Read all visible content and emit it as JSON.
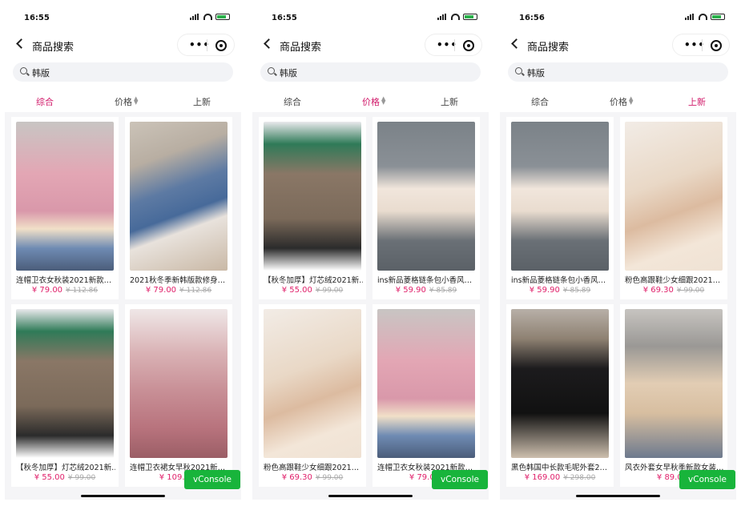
{
  "screens": [
    {
      "time": "16:55",
      "nav_title": "商品搜索",
      "search_query": "韩版",
      "sort": {
        "active": 0,
        "tabs": [
          "综合",
          "价格",
          "上新"
        ]
      },
      "products": [
        {
          "name": "连帽卫衣女秋装2021新款…",
          "price": "¥ 79.00",
          "old_price": "¥ 112.86",
          "image": "pink-hoodie"
        },
        {
          "name": "2021秋冬季新韩版款修身…",
          "price": "¥ 79.00",
          "old_price": "¥ 112.86",
          "image": "jeans-fur"
        },
        {
          "name": "【秋冬加厚】灯芯绒2021新…",
          "price": "¥ 55.00",
          "old_price": "¥ 99.00",
          "image": "corduroy"
        },
        {
          "name": "连帽卫衣裙女早秋2021新…",
          "price": "¥ 109.00",
          "old_price": "",
          "image": "pink-dress"
        }
      ],
      "vconsole": "vConsole"
    },
    {
      "time": "16:55",
      "nav_title": "商品搜索",
      "search_query": "韩版",
      "sort": {
        "active": 1,
        "tabs": [
          "综合",
          "价格",
          "上新"
        ]
      },
      "products": [
        {
          "name": "【秋冬加厚】灯芯绒2021新…",
          "price": "¥ 55.00",
          "old_price": "¥ 99.00",
          "image": "corduroy"
        },
        {
          "name": "ins新品菱格链条包小香风…",
          "price": "¥ 59.90",
          "old_price": "¥ 85.89",
          "image": "bag"
        },
        {
          "name": "粉色高跟鞋少女细跟2021…",
          "price": "¥ 69.30",
          "old_price": "¥ 99.00",
          "image": "heels"
        },
        {
          "name": "连帽卫衣女秋装2021新款…",
          "price": "¥ 79.00",
          "old_price": "",
          "image": "pink-hoodie"
        }
      ],
      "vconsole": "vConsole"
    },
    {
      "time": "16:56",
      "nav_title": "商品搜索",
      "search_query": "韩版",
      "sort": {
        "active": 2,
        "tabs": [
          "综合",
          "价格",
          "上新"
        ]
      },
      "products": [
        {
          "name": "ins新品菱格链条包小香风…",
          "price": "¥ 59.90",
          "old_price": "¥ 85.89",
          "image": "bag"
        },
        {
          "name": "粉色高跟鞋少女细跟2021…",
          "price": "¥ 69.30",
          "old_price": "¥ 99.00",
          "image": "heels"
        },
        {
          "name": "黑色韩国中长款毛呢外套2…",
          "price": "¥ 169.00",
          "old_price": "¥ 298.00",
          "image": "black-coat"
        },
        {
          "name": "风衣外套女早秋季新款女装…",
          "price": "¥ 89.00",
          "old_price": "",
          "image": "trench"
        }
      ],
      "vconsole": "vConsole"
    }
  ],
  "colors": {
    "accent": "#d11a6a",
    "price": "#e0206a",
    "vconsole": "#18b43b"
  },
  "icons": [
    "back-chevron-icon",
    "more-dots-icon",
    "close-target-icon",
    "search-icon",
    "sort-updown-icon",
    "signal-icon",
    "wifi-icon",
    "battery-icon"
  ]
}
